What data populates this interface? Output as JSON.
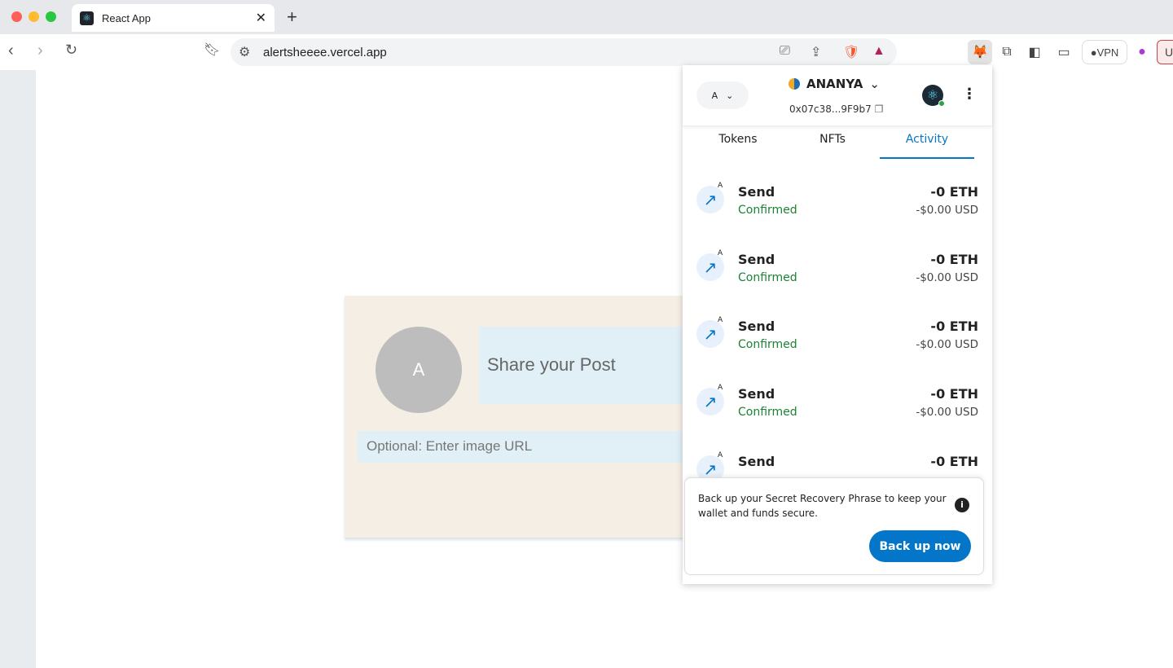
{
  "browser": {
    "tab_title": "React App",
    "url": "alertsheeee.vercel.app",
    "vpn_label": "VPN",
    "profile_label": "U"
  },
  "app": {
    "avatar_letter": "A",
    "post_placeholder": "Share your Post",
    "image_placeholder": "Optional: Enter image URL"
  },
  "wallet": {
    "account_picker": "A",
    "account_name": "ANANYA",
    "address": "0x07c38...9F9b7",
    "tabs": [
      "Tokens",
      "NFTs",
      "Activity"
    ],
    "active_tab": "Activity",
    "activity": [
      {
        "badge": "A",
        "title": "Send",
        "status": "Confirmed",
        "amount": "-0 ETH",
        "usd": "-$0.00 USD"
      },
      {
        "badge": "A",
        "title": "Send",
        "status": "Confirmed",
        "amount": "-0 ETH",
        "usd": "-$0.00 USD"
      },
      {
        "badge": "A",
        "title": "Send",
        "status": "Confirmed",
        "amount": "-0 ETH",
        "usd": "-$0.00 USD"
      },
      {
        "badge": "A",
        "title": "Send",
        "status": "Confirmed",
        "amount": "-0 ETH",
        "usd": "-$0.00 USD"
      },
      {
        "badge": "A",
        "title": "Send",
        "status": "",
        "amount": "-0 ETH",
        "usd": ""
      }
    ],
    "banner_text": "Back up your Secret Recovery Phrase to keep your wallet and funds secure.",
    "banner_button": "Back up now"
  },
  "colors": {
    "accent": "#0376c9",
    "confirmed": "#1c8234"
  }
}
